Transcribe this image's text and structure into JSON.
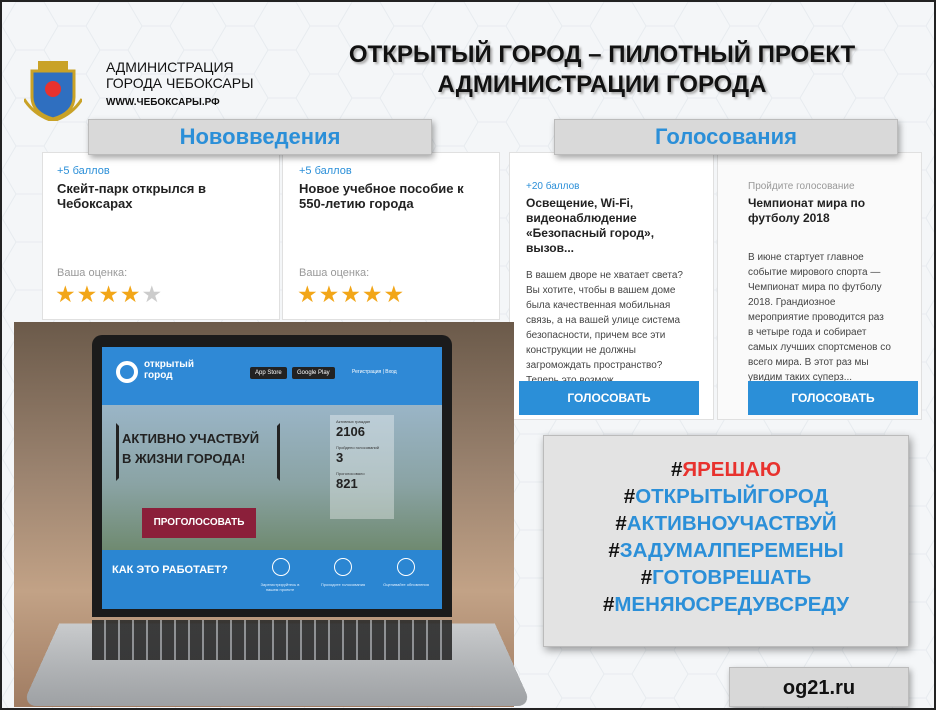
{
  "header": {
    "admin_line1": "АДМИНИСТРАЦИЯ",
    "admin_line2": "ГОРОДА ЧЕБОКСАРЫ",
    "website": "WWW.ЧЕБОКСАРЫ.РФ",
    "title_line1": "ОТКРЫТЫЙ ГОРОД – ПИЛОТНЫЙ ПРОЕКТ",
    "title_line2": "АДМИНИСТРАЦИИ ГОРОДА"
  },
  "innovations": {
    "banner": "Нововведения",
    "cards": [
      {
        "points": "+5 баллов",
        "title": "Скейт-парк открылся в Чебоксарах",
        "rating_label": "Ваша оценка:",
        "stars_on": 4,
        "stars_total": 5
      },
      {
        "points": "+5 баллов",
        "title": "Новое учебное пособие к 550-летию города",
        "rating_label": "Ваша оценка:",
        "stars_on": 5,
        "stars_total": 5
      }
    ]
  },
  "voting": {
    "banner": "Голосования",
    "cards": [
      {
        "points": "+20 баллов",
        "title": "Освещение, Wi-Fi, видеонаблюдение «Безопасный город», вызов...",
        "text": "В вашем дворе не хватает света? Вы хотите, чтобы в вашем доме была качественная мобильная связь, а на вашей улице система безопасности, причем все эти конструкции не должны загромождать пространство? Теперь это возмож...",
        "button": "ГОЛОСОВАТЬ"
      },
      {
        "points": "Пройдите голосование",
        "title": "Чемпионат мира по футболу 2018",
        "text": "В июне стартует главное событие мирового спорта — Чемпионат мира по футболу 2018. Грандиозное мероприятие проводится раз в четыре года и собирает самых лучших спортсменов со всего мира. В этот раз мы увидим таких суперз...",
        "button": "ГОЛОСОВАТЬ"
      }
    ]
  },
  "laptop_screen": {
    "logo_line1": "открытый",
    "logo_line2": "город",
    "app_store": "App Store",
    "google_play": "Google Play",
    "login": "Регистрация | Вход",
    "slogan_line1": "АКТИВНО УЧАСТВУЙ",
    "slogan_line2": "В ЖИЗНИ ГОРОДА!",
    "stat1_label": "Активных граждан",
    "stat1_value": "2106",
    "stat2_label": "Пройдено голосований",
    "stat2_value": "3",
    "stat3_label": "Проголосовало",
    "stat3_value": "821",
    "vote_button": "ПРОГОЛОСОВАТЬ",
    "how_it_works": "КАК ЭТО РАБОТАЕТ?",
    "step1": "Зарегистрируйтесь в нашем проекте",
    "step2": "Проходите голосования",
    "step3": "Оценивайте обновления"
  },
  "hashtags": [
    {
      "hash": "#",
      "word": "ЯРЕШАЮ",
      "color": "red"
    },
    {
      "hash": "#",
      "word": "ОТКРЫТЫЙГОРОД",
      "color": "blue"
    },
    {
      "hash": "#",
      "word": "АКТИВНОУЧАСТВУЙ",
      "color": "blue"
    },
    {
      "hash": "#",
      "word": "ЗАДУМАЛПЕРЕМЕНЫ",
      "color": "blue"
    },
    {
      "hash": "#",
      "word": "ГОТОВРЕШАТЬ",
      "color": "blue"
    },
    {
      "hash": "#",
      "word": "МЕНЯЮСРЕДУВСРЕДУ",
      "color": "blue"
    }
  ],
  "footer_site": "og21.ru",
  "colors": {
    "accent": "#2b8fd8",
    "red": "#e8322e",
    "star": "#f2a618"
  }
}
